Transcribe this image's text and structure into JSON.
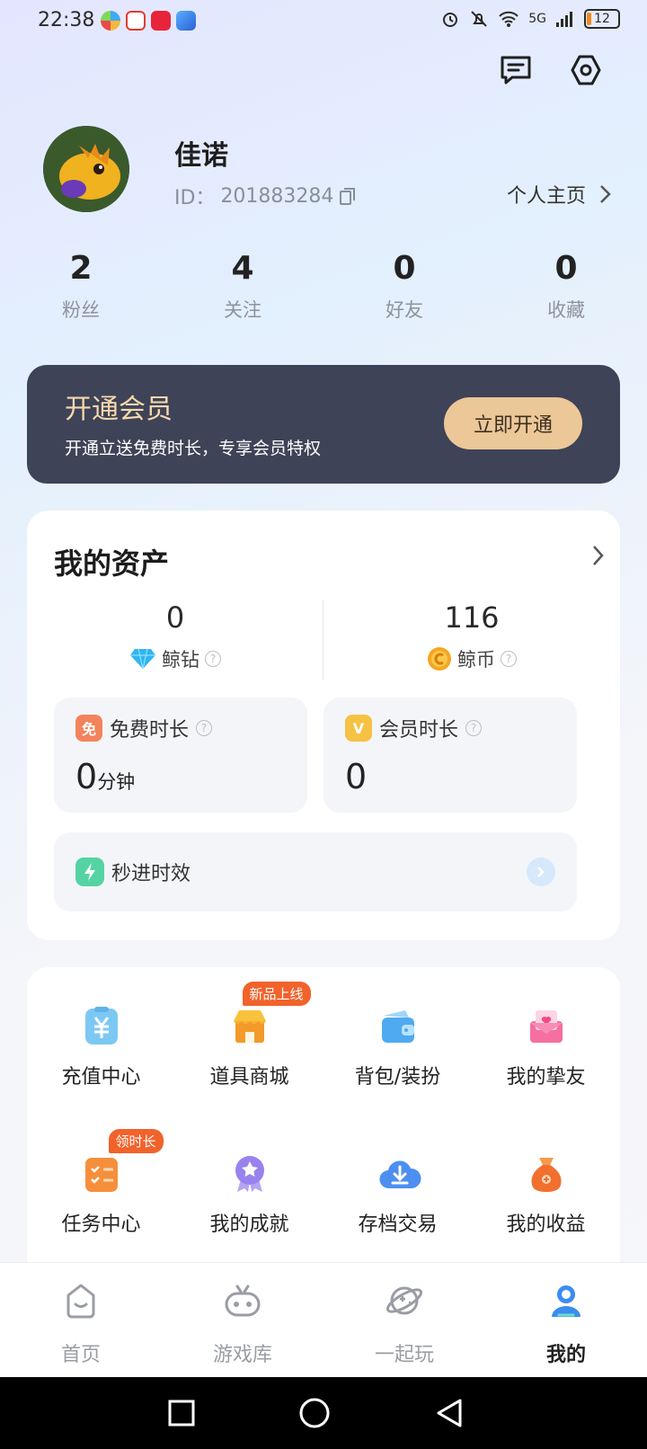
{
  "status": {
    "time": "22:38",
    "network": "5G",
    "battery": "12"
  },
  "profile": {
    "name": "佳诺",
    "id_label": "ID：",
    "id_value": "201883284",
    "homepage": "个人主页"
  },
  "stats": [
    {
      "value": "2",
      "label": "粉丝"
    },
    {
      "value": "4",
      "label": "关注"
    },
    {
      "value": "0",
      "label": "好友"
    },
    {
      "value": "0",
      "label": "收藏"
    }
  ],
  "vip": {
    "title": "开通会员",
    "subtitle": "开通立送免费时长，专享会员特权",
    "button": "立即开通"
  },
  "assets": {
    "title": "我的资产",
    "diamond": {
      "value": "0",
      "label": "鲸钻"
    },
    "coin": {
      "value": "116",
      "label": "鲸币"
    },
    "free_time": {
      "badge": "免",
      "label": "免费时长",
      "value": "0",
      "unit": "分钟"
    },
    "vip_time": {
      "badge": "V",
      "label": "会员时长",
      "value": "0"
    },
    "speed": {
      "label": "秒进时效"
    }
  },
  "services": [
    {
      "label": "充值中心",
      "icon": "recharge-icon"
    },
    {
      "label": "道具商城",
      "icon": "shop-icon",
      "tag": "新品上线"
    },
    {
      "label": "背包/装扮",
      "icon": "wallet-icon"
    },
    {
      "label": "我的挚友",
      "icon": "friend-mail-icon"
    },
    {
      "label": "任务中心",
      "icon": "task-icon",
      "tag": "领时长"
    },
    {
      "label": "我的成就",
      "icon": "medal-icon"
    },
    {
      "label": "存档交易",
      "icon": "cloud-download-icon"
    },
    {
      "label": "我的收益",
      "icon": "money-bag-icon"
    }
  ],
  "tabs": [
    {
      "label": "首页"
    },
    {
      "label": "游戏库"
    },
    {
      "label": "一起玩"
    },
    {
      "label": "我的"
    }
  ],
  "colors": {
    "vip_bg": "#3f4357",
    "vip_gold": "#ecc797",
    "accent_blue": "#3b8df0",
    "tag_orange": "#f2622b"
  }
}
